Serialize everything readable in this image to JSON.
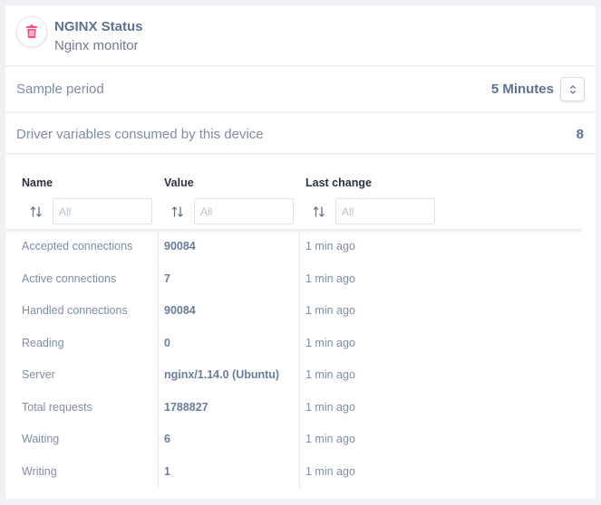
{
  "device": {
    "title": "NGINX Status",
    "subtitle": "Nginx monitor",
    "icon": "trash-icon",
    "icon_color": "#ef4f8a"
  },
  "sample_period": {
    "label": "Sample period",
    "value": "5 Minutes"
  },
  "drivers": {
    "label": "Driver variables consumed by this device",
    "count": "8"
  },
  "table": {
    "columns": [
      {
        "label": "Name",
        "filter_placeholder": "All"
      },
      {
        "label": "Value",
        "filter_placeholder": "All"
      },
      {
        "label": "Last change",
        "filter_placeholder": "All"
      }
    ],
    "rows": [
      {
        "name": "Accepted connections",
        "value": "90084",
        "last_change": "1 min ago"
      },
      {
        "name": "Active connections",
        "value": "7",
        "last_change": "1 min ago"
      },
      {
        "name": "Handled connections",
        "value": "90084",
        "last_change": "1 min ago"
      },
      {
        "name": "Reading",
        "value": "0",
        "last_change": "1 min ago"
      },
      {
        "name": "Server",
        "value": "nginx/1.14.0 (Ubuntu)",
        "last_change": "1 min ago"
      },
      {
        "name": "Total requests",
        "value": "1788827",
        "last_change": "1 min ago"
      },
      {
        "name": "Waiting",
        "value": "6",
        "last_change": "1 min ago"
      },
      {
        "name": "Writing",
        "value": "1",
        "last_change": "1 min ago"
      }
    ]
  }
}
